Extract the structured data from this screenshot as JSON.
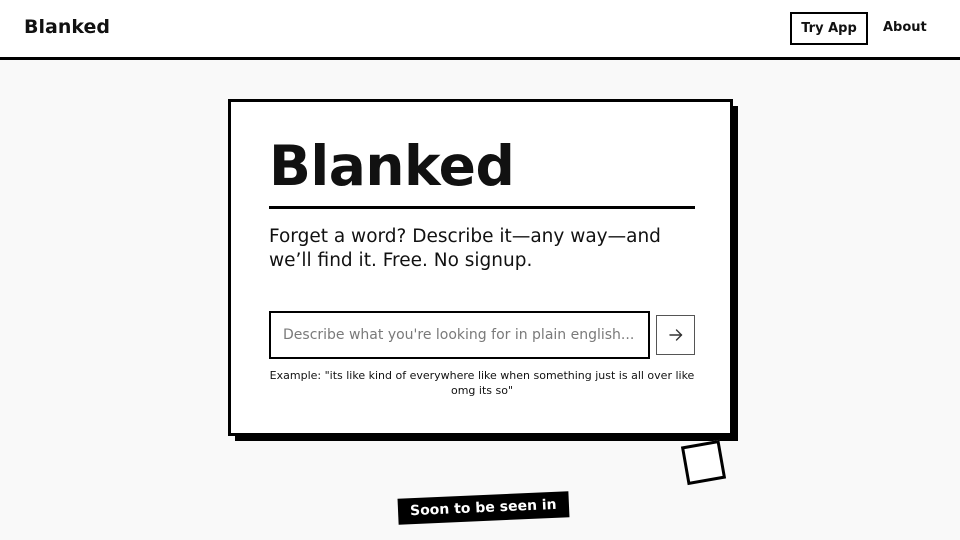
{
  "header": {
    "brand": "Blanked",
    "nav": {
      "try_app": "Try App",
      "about": "About"
    }
  },
  "hero": {
    "title": "Blanked",
    "tagline": "Forget a word? Describe it—any way—and we’ll find it. Free. No signup.",
    "search": {
      "value": "",
      "placeholder": "Describe what you're looking for in plain english..."
    },
    "submit_icon": "arrow-right-icon",
    "example": "Example: \"its like kind of everywhere like when something just is all over like omg its so\""
  },
  "badge": {
    "label": "Soon to be seen in"
  },
  "colors": {
    "background": "#f9f9f9",
    "ink": "#000000",
    "card": "#ffffff"
  }
}
